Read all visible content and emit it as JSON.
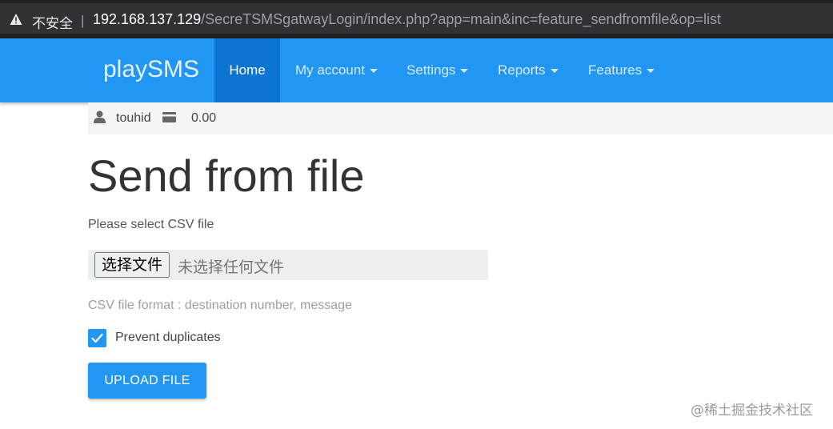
{
  "browser": {
    "security_label": "不安全",
    "separator": "|",
    "url_host": "192.168.137.129",
    "url_path": "/SecreTSMSgatwayLogin/index.php?app=main&inc=feature_sendfromfile&op=list"
  },
  "navbar": {
    "brand": "playSMS",
    "items": [
      {
        "label": "Home",
        "active": true,
        "dropdown": false
      },
      {
        "label": "My account",
        "dropdown": true
      },
      {
        "label": "Settings",
        "dropdown": true
      },
      {
        "label": "Reports",
        "dropdown": true
      },
      {
        "label": "Features",
        "dropdown": true
      }
    ],
    "color": "#2196f3"
  },
  "userbar": {
    "username": "touhid",
    "credit": "0.00"
  },
  "main": {
    "title": "Send from file",
    "select_label": "Please select CSV file",
    "file_button": "选择文件",
    "file_status": "未选择任何文件",
    "format_hint": "CSV file format : destination number, message",
    "prevent_duplicates_label": "Prevent duplicates",
    "prevent_duplicates_checked": true,
    "upload_button": "UPLOAD FILE"
  },
  "watermark": "@稀土掘金技术社区"
}
